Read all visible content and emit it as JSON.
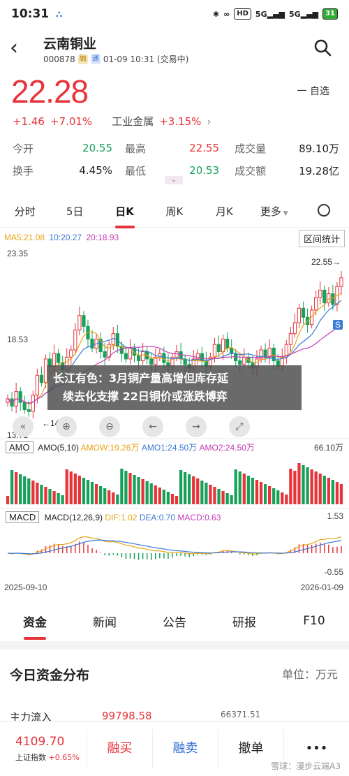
{
  "status_bar": {
    "time": "10:31",
    "signal1": "5G",
    "signal2": "5G",
    "battery": "31",
    "hd": "HD"
  },
  "header": {
    "title": "云南铜业",
    "code": "000878",
    "tag1": "融",
    "tag2": "通",
    "datetime": "01-09 10:31 (交易中)"
  },
  "quote": {
    "price": "22.28",
    "change": "+1.46",
    "change_pct": "+7.01%",
    "sector": "工业金属",
    "sector_pct": "+3.15%",
    "watch_label": "一 自选",
    "stats": [
      {
        "l1": "今开",
        "v1": "20.55",
        "l2": "最高",
        "v2": "22.55",
        "l3": "成交量",
        "v3": "89.10万"
      },
      {
        "l1": "换手",
        "v1": "4.45%",
        "l2": "最低",
        "v2": "20.53",
        "l3": "成交额",
        "v3": "19.28亿"
      }
    ]
  },
  "chart_tabs": [
    "分时",
    "5日",
    "日K",
    "周K",
    "月K",
    "更多"
  ],
  "kline": {
    "ma5": "MA5:21.08",
    "ma10": "10:20.27",
    "ma20": "20:18.93",
    "interval_btn": "区间统计",
    "y_high": "23.35",
    "y_mid": "18.53",
    "y_low": "13.71",
    "max_label": "22.55→",
    "min_label": "←14.77",
    "s_badge": "S"
  },
  "amo": {
    "name": "AMO",
    "params": "AMO(5,10)",
    "amow": "AMOW:19.26万",
    "amo1": "AMO1:24.50万",
    "amo2": "AMO2:24.50万",
    "ymax": "66.10万"
  },
  "macd": {
    "name": "MACD",
    "params": "MACD(12,26,9)",
    "dif": "DIF:1.02",
    "dea": "DEA:0.70",
    "macd": "MACD:0.63",
    "ymax": "1.53",
    "ymin": "-0.55",
    "date_start": "2025-09-10",
    "date_end": "2026-01-09"
  },
  "overlay": {
    "line1": "长江有色：3月铜产量高增但库存延",
    "line2": "续去化支撑 22日铜价或涨跌博弈"
  },
  "news_tabs": [
    "资金",
    "新闻",
    "公告",
    "研报",
    "F10"
  ],
  "fund": {
    "title": "今日资金分布",
    "unit": "单位：万元",
    "row_label": "主力流入",
    "row_value": "99798.58",
    "row_value2": "66371.51"
  },
  "bottom": {
    "index_value": "4109.70",
    "index_name": "上证指数",
    "index_pct": "+0.65%",
    "buy": "融买",
    "sell": "融卖",
    "cancel": "撤单",
    "more": "•••"
  },
  "watermark": "雪球：漫步云端A3",
  "chart_data": [
    {
      "type": "candlestick",
      "title": "日K",
      "y_range": [
        13.71,
        23.35
      ],
      "x_range": [
        "2025-09-10",
        "2026-01-09"
      ],
      "series": [
        {
          "name": "MA5",
          "last": 21.08
        },
        {
          "name": "MA10",
          "last": 20.27
        },
        {
          "name": "MA20",
          "last": 18.93
        }
      ],
      "max": 22.55,
      "min": 14.77,
      "closes": [
        15.6,
        15.2,
        16.0,
        15.4,
        15.0,
        14.9,
        15.8,
        16.9,
        16.5,
        17.8,
        17.4,
        18.1,
        17.6,
        17.2,
        17.9,
        18.3,
        19.4,
        20.2,
        19.6,
        18.9,
        18.4,
        18.9,
        18.2,
        17.9,
        18.6,
        19.2,
        18.5,
        18.1,
        17.8,
        18.4,
        18.0,
        17.7,
        18.2,
        17.8,
        17.5,
        17.9,
        18.1,
        17.6,
        17.4,
        17.9,
        18.2,
        17.8,
        17.5,
        17.3,
        17.8,
        18.1,
        17.7,
        17.4,
        17.9,
        18.6,
        18.2,
        18.9,
        18.4,
        18.1,
        17.7,
        17.5,
        17.9,
        17.6,
        17.3,
        17.8,
        18.3,
        17.9,
        18.4,
        17.7,
        17.4,
        17.9,
        18.6,
        19.2,
        19.8,
        20.6,
        20.1,
        19.7,
        20.5,
        21.2,
        21.6,
        20.9,
        21.4,
        20.8,
        21.8,
        22.28
      ]
    }
  ]
}
